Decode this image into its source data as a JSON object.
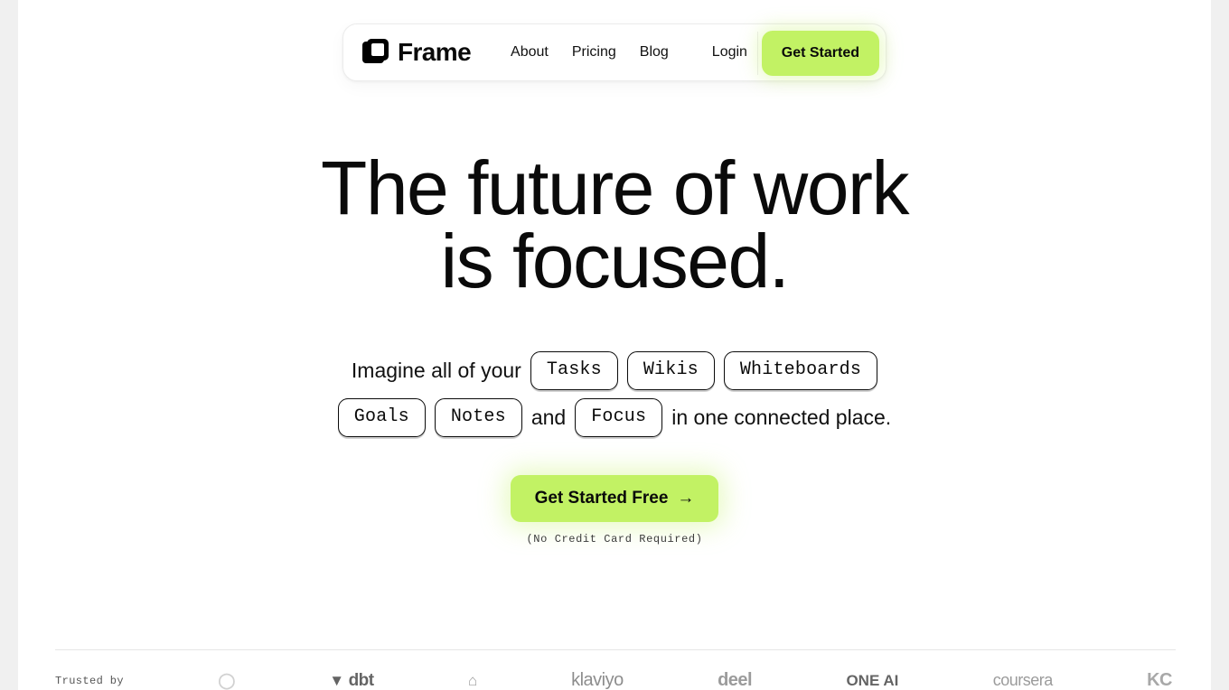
{
  "theme": {
    "accent_green": "#c2f264",
    "text_black": "#0a0a0a",
    "page_bg": "#ffffff",
    "gutter_bg": "#f0f0f0"
  },
  "nav": {
    "brand": "Frame",
    "logo_icon": "frame-square-logo-icon",
    "links": [
      {
        "label": "About"
      },
      {
        "label": "Pricing"
      },
      {
        "label": "Blog"
      },
      {
        "label": "Login"
      }
    ],
    "cta": "Get Started"
  },
  "hero": {
    "title_line1": "The future of work",
    "title_line2": "is focused."
  },
  "subhead": {
    "lead": "Imagine all of your",
    "chips_row1": [
      "Tasks",
      "Wikis",
      "Whiteboards",
      "Goals"
    ],
    "chip_notes": "Notes",
    "conjunction": "and",
    "chip_focus": "Focus",
    "tail": "in one connected place."
  },
  "cta": {
    "label": "Get Started Free",
    "arrow": "→",
    "note": "(No Credit Card Required)"
  },
  "trusted": {
    "label": "Trusted by",
    "logos": [
      {
        "name": "monogram",
        "glyph": "◯",
        "text": ""
      },
      {
        "name": "dbt",
        "glyph": "▼",
        "text": "dbt"
      },
      {
        "name": "arch-mark",
        "glyph": "⌂",
        "text": ""
      },
      {
        "name": "klaviyo",
        "glyph": "",
        "text": "klaviyo"
      },
      {
        "name": "deel",
        "glyph": "",
        "text": "deel"
      },
      {
        "name": "one-ai",
        "glyph": "",
        "text": "ONE AI"
      },
      {
        "name": "coursera",
        "glyph": "",
        "text": "coursera"
      },
      {
        "name": "kc",
        "glyph": "",
        "text": "KC"
      }
    ]
  }
}
